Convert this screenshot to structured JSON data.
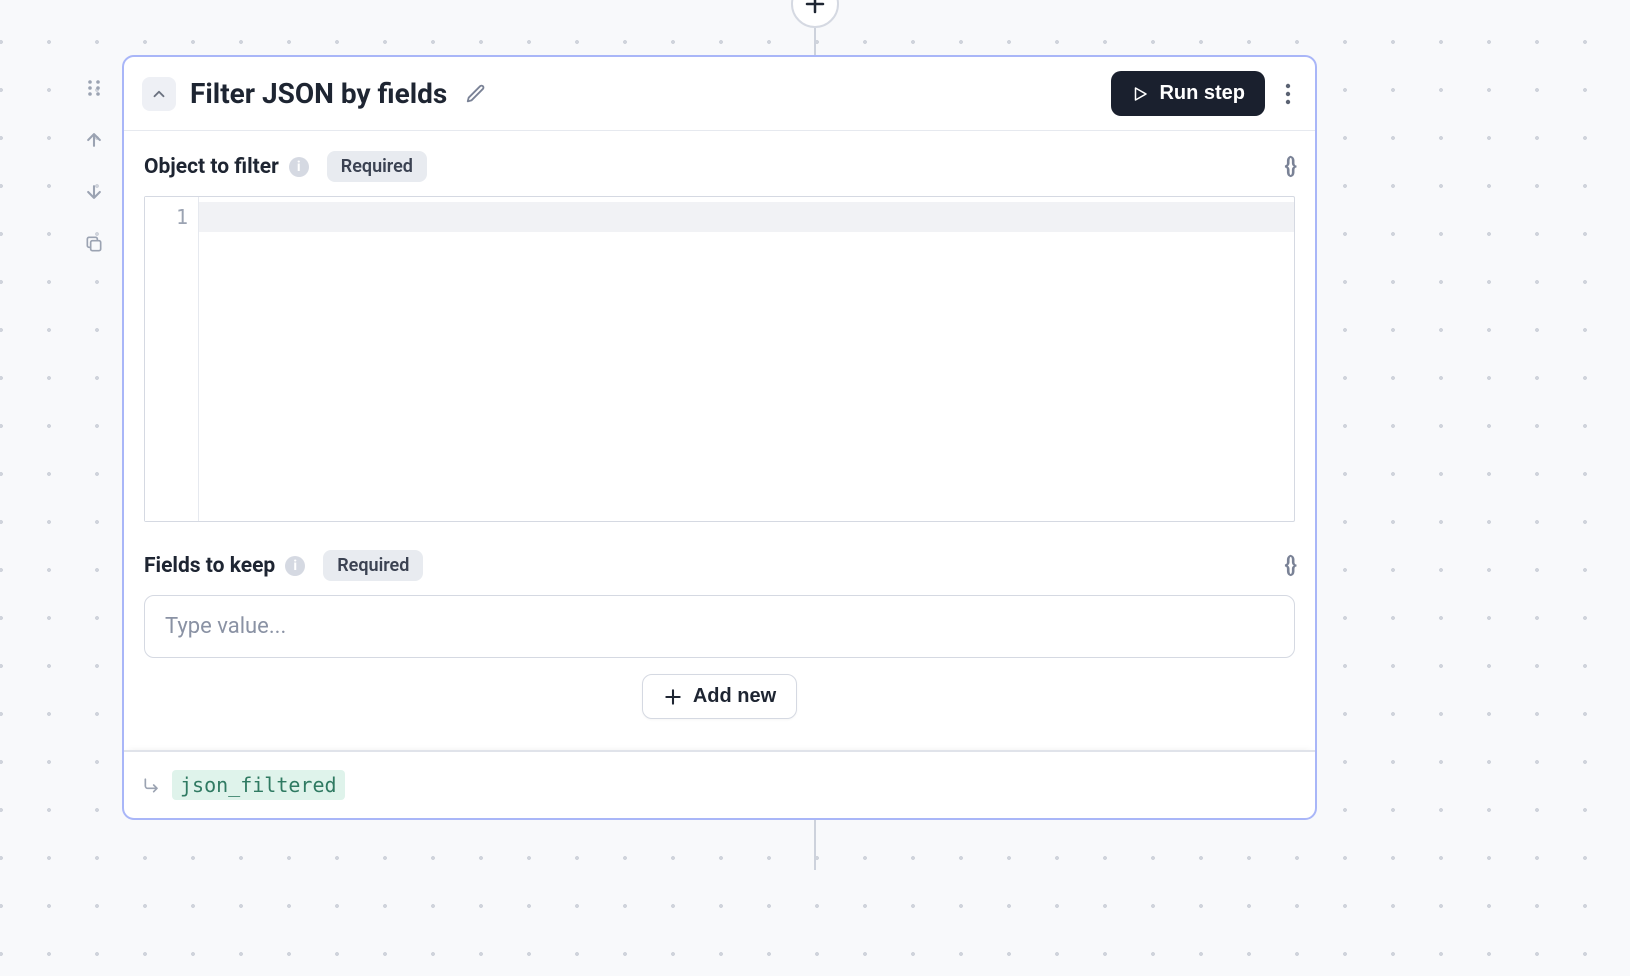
{
  "header": {
    "title": "Filter JSON by fields",
    "run_button_label": "Run step"
  },
  "fields": {
    "object_to_filter": {
      "label": "Object to filter",
      "required_badge": "Required",
      "line_number": "1"
    },
    "fields_to_keep": {
      "label": "Fields to keep",
      "required_badge": "Required",
      "input_placeholder": "Type value..."
    }
  },
  "add_new_label": "Add new",
  "output": {
    "variable_name": "json_filtered"
  },
  "info_glyph": "i",
  "braces_glyph": "{}"
}
